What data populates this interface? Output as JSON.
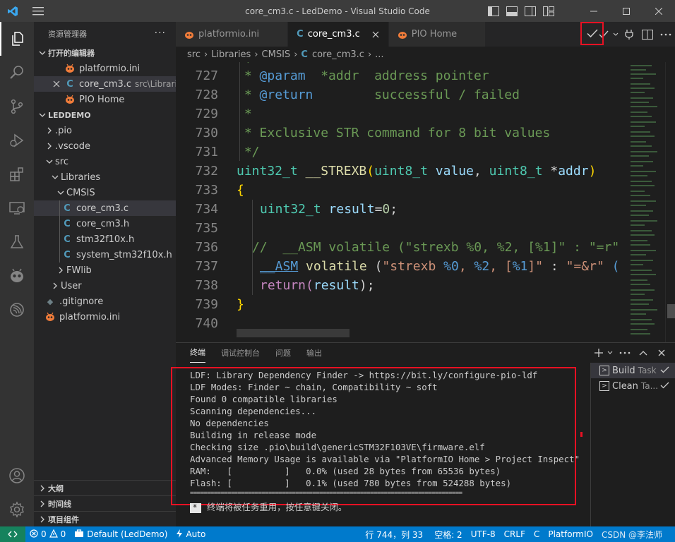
{
  "window": {
    "title": "core_cm3.c - LedDemo - Visual Studio Code"
  },
  "sidebar": {
    "header": "资源管理器",
    "more": "···",
    "open_editors": {
      "title": "打开的编辑器",
      "items": [
        {
          "name": "platformio.ini",
          "desc": ""
        },
        {
          "name": "core_cm3.c",
          "desc": "src\\Librarie..."
        },
        {
          "name": "PIO Home",
          "desc": ""
        }
      ]
    },
    "project": {
      "title": "LEDDEMO",
      "items": [
        {
          "name": ".pio"
        },
        {
          "name": ".vscode"
        },
        {
          "name": "src"
        },
        {
          "name": "Libraries"
        },
        {
          "name": "CMSIS"
        },
        {
          "name": "core_cm3.c"
        },
        {
          "name": "core_cm3.h"
        },
        {
          "name": "stm32f10x.h"
        },
        {
          "name": "system_stm32f10x.h"
        },
        {
          "name": "FWlib"
        },
        {
          "name": "User"
        },
        {
          "name": ".gitignore"
        },
        {
          "name": "platformio.ini"
        }
      ]
    },
    "bottom_sections": [
      "大纲",
      "时间线",
      "项目组件"
    ]
  },
  "tabs": [
    {
      "label": "platformio.ini"
    },
    {
      "label": "core_cm3.c"
    },
    {
      "label": "PIO Home"
    }
  ],
  "breadcrumb": {
    "parts": [
      "src",
      "Libraries",
      "CMSIS",
      "core_cm3.c",
      "..."
    ]
  },
  "editor": {
    "line_numbers": [
      "727",
      "728",
      "729",
      "730",
      "731",
      "732",
      "733",
      "734",
      "735",
      "736",
      "737",
      "738",
      "739",
      "740"
    ],
    "lines": {
      "l727": [
        " * ",
        "@param",
        "  *addr  address pointer"
      ],
      "l728": [
        " * ",
        "@return",
        "        successful / failed"
      ],
      "l729": " *",
      "l730": " * Exclusive STR command for 8 bit values",
      "l731": " */",
      "l732": [
        "uint32_t",
        " ",
        "__STREXB",
        "(",
        "uint8_t",
        " ",
        "value",
        ", ",
        "uint8_t",
        " *",
        "addr",
        ")"
      ],
      "l733": "{",
      "l734": [
        "uint32_t",
        " ",
        "result",
        "=",
        "0",
        ";"
      ],
      "l736": "//  __ASM volatile (\"strexb %0, %2, [%1]\" : \"=r\"",
      "l737": [
        "__ASM",
        " ",
        "volatile",
        " (",
        "\"strexb ",
        "%0",
        ", ",
        "%2",
        ", [",
        "%1",
        "]\"",
        " : ",
        "\"=&r\"",
        " ("
      ],
      "l738": [
        "return",
        "(",
        "result",
        ");"
      ],
      "l739": "}"
    }
  },
  "panel": {
    "tabs": [
      "终端",
      "调试控制台",
      "问题",
      "输出"
    ],
    "terminal_lines": [
      "LDF: Library Dependency Finder -> https://bit.ly/configure-pio-ldf",
      "LDF Modes: Finder ~ chain, Compatibility ~ soft",
      "Found 0 compatible libraries",
      "Scanning dependencies...",
      "No dependencies",
      "Building in release mode",
      "Checking size .pio\\build\\genericSTM32F103VE\\firmware.elf",
      "Advanced Memory Usage is available via \"PlatformIO Home > Project Inspect\"",
      "RAM:   [          ]   0.0% (used 28 bytes from 65536 bytes)",
      "Flash: [          ]   0.1% (used 780 bytes from 524288 bytes)",
      "================================================================================"
    ],
    "terminal_footer": "终端将被任务重用，按任意键关闭。",
    "tasks": [
      {
        "name": "Build",
        "label": "Task"
      },
      {
        "name": "Clean",
        "label": "Ta..."
      }
    ]
  },
  "statusbar": {
    "errors": "0",
    "warnings": "0",
    "env": "Default (LedDemo)",
    "auto": "Auto",
    "position": "行 744，列 33",
    "spaces": "空格: 2",
    "encoding": "UTF-8",
    "eol": "CRLF",
    "language": "C",
    "platformio": "PlatformIO",
    "watermark": "CSDN @李法师"
  },
  "colors": {
    "accent": "#007acc",
    "highlight_box": "#e81123",
    "remote": "#16825d",
    "pio_orange": "#f07c3a"
  }
}
